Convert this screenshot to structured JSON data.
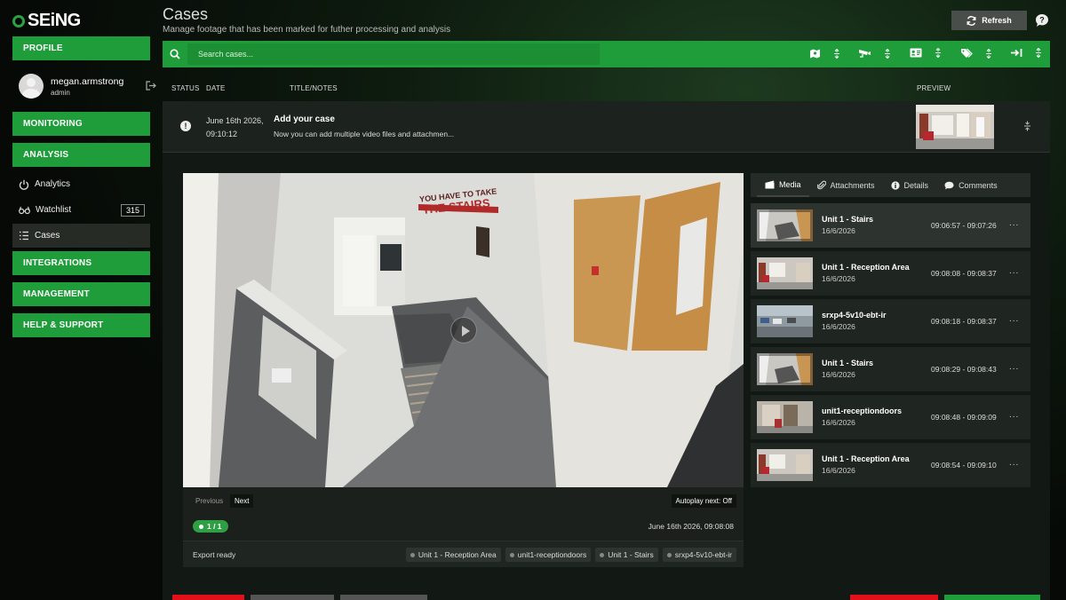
{
  "app": {
    "logo_text": "SEiNG"
  },
  "sidebar": {
    "profile_label": "PROFILE",
    "user": {
      "name": "megan.armstrong",
      "role": "admin"
    },
    "monitoring_label": "MONITORING",
    "analysis_label": "ANALYSIS",
    "analysis_items": [
      {
        "label": "Analytics",
        "icon": "power-icon"
      },
      {
        "label": "Watchlist",
        "icon": "glasses-icon",
        "badge": "315"
      },
      {
        "label": "Cases",
        "icon": "list-icon"
      }
    ],
    "integrations_label": "INTEGRATIONS",
    "management_label": "MANAGEMENT",
    "help_label": "HELP & SUPPORT"
  },
  "header": {
    "title": "Cases",
    "subtitle": "Manage footage that has been marked for futher processing and analysis",
    "refresh_label": "Refresh"
  },
  "search": {
    "placeholder": "Search cases..."
  },
  "table": {
    "headers": {
      "status": "STATUS",
      "date": "DATE",
      "title": "TITLE/NOTES",
      "preview": "PREVIEW"
    },
    "row": {
      "date_line1": "June 16th 2026,",
      "date_line2": "09:10:12",
      "title": "Add your case",
      "notes": "Now you can add multiple video files and attachmen..."
    }
  },
  "player": {
    "sign_line1": "YOU HAVE TO TAKE",
    "sign_line2": "THE STAIRS",
    "previous_label": "Previous",
    "next_label": "Next",
    "autoplay_label": "Autoplay next: Off",
    "pager": "1 / 1",
    "timestamp": "June 16th 2026, 09:08:08",
    "export_status": "Export ready",
    "tags": [
      "Unit 1 - Reception Area",
      "unit1-receptiondoors",
      "Unit 1 - Stairs",
      "srxp4-5v10-ebt-ir"
    ]
  },
  "media_panel": {
    "tabs": [
      {
        "label": "Media",
        "icon": "film-icon"
      },
      {
        "label": "Attachments",
        "icon": "paperclip-icon"
      },
      {
        "label": "Details",
        "icon": "info-icon"
      },
      {
        "label": "Comments",
        "icon": "comment-icon"
      }
    ],
    "items": [
      {
        "title": "Unit 1 - Stairs",
        "date": "16/6/2026",
        "range": "09:06:57 - 09:07:26",
        "more": "..."
      },
      {
        "title": "Unit 1 - Reception Area",
        "date": "16/6/2026",
        "range": "09:08:08 - 09:08:37",
        "more": "..."
      },
      {
        "title": "srxp4-5v10-ebt-ir",
        "date": "16/6/2026",
        "range": "09:08:18 - 09:08:37",
        "more": "..."
      },
      {
        "title": "Unit 1 - Stairs",
        "date": "16/6/2026",
        "range": "09:08:29 - 09:08:43",
        "more": "..."
      },
      {
        "title": "unit1-receptiondoors",
        "date": "16/6/2026",
        "range": "09:08:48 - 09:09:09",
        "more": "..."
      },
      {
        "title": "Unit 1 - Reception Area",
        "date": "16/6/2026",
        "range": "09:08:54 - 09:09:10",
        "more": "..."
      }
    ]
  },
  "colors": {
    "accent": "#1f9d3a",
    "danger": "#e3101a",
    "panel": "#1f2520"
  }
}
